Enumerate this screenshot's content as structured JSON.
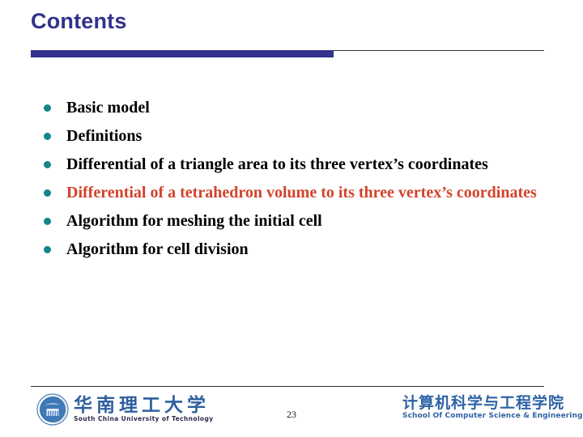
{
  "slide": {
    "title": "Contents",
    "page_number": "23",
    "colors": {
      "title_blue": "#33328c",
      "rule_dark": "#2e2e3f",
      "bullet_teal": "#13868a",
      "highlight_red": "#d2432a",
      "body_black": "#000000",
      "logo_blue": "#2f63a6"
    }
  },
  "bullets": [
    {
      "text": "Basic model",
      "highlighted": false
    },
    {
      "text": "Definitions",
      "highlighted": false
    },
    {
      "text": "Differential of a triangle area to its three vertex’s coordinates",
      "highlighted": false
    },
    {
      "text": "Differential of a tetrahedron volume to its three vertex’s coordinates",
      "highlighted": true
    },
    {
      "text": "Algorithm for meshing the initial cell",
      "highlighted": false
    },
    {
      "text": "Algorithm for cell division",
      "highlighted": false
    }
  ],
  "footer": {
    "university_logo": {
      "chinese": "华南理工大学",
      "english": "South China University of Technology"
    },
    "school_logo": {
      "chinese": "计算机科学与工程学院",
      "english": "School Of Computer Science & Engineering"
    }
  }
}
